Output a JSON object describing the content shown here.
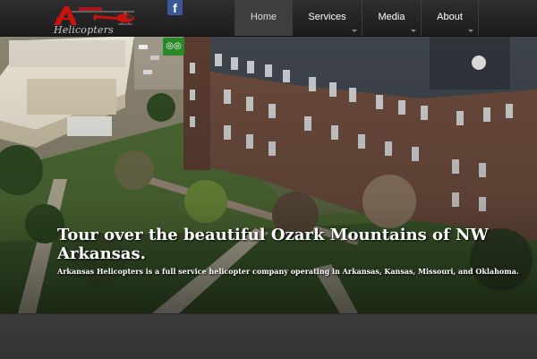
{
  "header": {
    "logo": {
      "text": "Helicopters",
      "icon": "helicopter-logo-icon",
      "brand_color": "#cc1111"
    },
    "facebook": {
      "glyph": "f",
      "icon": "facebook-icon",
      "color": "#3b5998"
    }
  },
  "nav": {
    "items": [
      {
        "label": "Home",
        "active": true,
        "has_dropdown": false
      },
      {
        "label": "Services",
        "active": false,
        "has_dropdown": true
      },
      {
        "label": "Media",
        "active": false,
        "has_dropdown": true
      },
      {
        "label": "About",
        "active": false,
        "has_dropdown": true
      }
    ]
  },
  "hero": {
    "badge": {
      "glyph": "◎◎",
      "icon": "tripadvisor-owl-icon"
    },
    "title": "Tour over the beautiful Ozark Mountains of NW Arkansas.",
    "subtitle": "Arkansas Helicopters is a full service helicopter company operating in Arkansas, Kansas, Missouri, and Oklahoma."
  }
}
